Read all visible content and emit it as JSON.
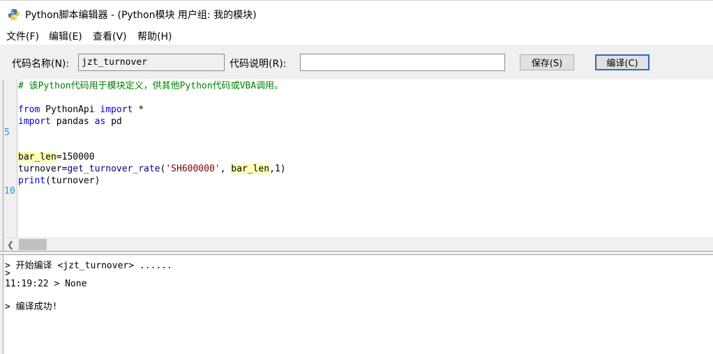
{
  "window": {
    "title": "Python脚本编辑器 - (Python模块 用户组: 我的模块)",
    "icon": "python-logo-icon"
  },
  "menu": {
    "items": [
      "文件(F)",
      "编辑(E)",
      "查看(V)",
      "帮助(H)"
    ]
  },
  "toolbar": {
    "name_label": "代码名称(N):",
    "name_value": "jzt_turnover",
    "desc_label": "代码说明(R):",
    "desc_value": "",
    "save_label": "保存(S)",
    "compile_label": "编译(C)"
  },
  "editor": {
    "gutter_numbers": [
      "5",
      "10"
    ],
    "code": {
      "comment": "# 该Python代码用于模块定义，供其他Python代码或VBA调用。",
      "l3_kw1": "from",
      "l3_mid": " PythonApi ",
      "l3_kw2": "import",
      "l3_end": " *",
      "l4_kw1": "import",
      "l4_mid": " pandas ",
      "l4_kw2": "as",
      "l4_end": " pd",
      "l7_var": "bar_len",
      "l7_rest": "=150000",
      "l8_a": "turnover=",
      "l8_fn": "get_turnover_rate",
      "l8_b": "(",
      "l8_str": "'SH600000'",
      "l8_c": ", ",
      "l8_var": "bar_len",
      "l8_d": ",1)",
      "l9_fn": "print",
      "l9_rest": "(turnover)"
    }
  },
  "output": {
    "lines": [
      "> 开始编译 <jzt_turnover> ......",
      ">",
      "11:19:22 > None",
      "> 编译成功!"
    ]
  },
  "colors": {
    "comment": "#008000",
    "keyword": "#0000c8",
    "string": "#800000",
    "highlight": "#ffffb4",
    "line_number": "#1a9dc9",
    "button_focus_border": "#2b66c9"
  }
}
